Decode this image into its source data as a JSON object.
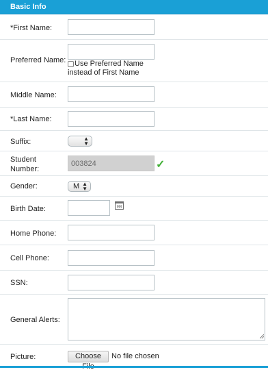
{
  "header": {
    "title": "Basic Info"
  },
  "form": {
    "first_name": {
      "label": "*First Name:",
      "value": ""
    },
    "preferred_name": {
      "label": "Preferred Name:",
      "value": "",
      "checkbox_label_line1": "Use Preferred Name",
      "checkbox_label_line2": "instead of First Name",
      "checked": false
    },
    "middle_name": {
      "label": "Middle Name:",
      "value": ""
    },
    "last_name": {
      "label": "*Last Name:",
      "value": ""
    },
    "suffix": {
      "label": "Suffix:",
      "value": ""
    },
    "student_number": {
      "label_line1": "Student",
      "label_line2": "Number:",
      "value": "003824",
      "status_icon": "check-icon"
    },
    "gender": {
      "label": "Gender:",
      "value": "M"
    },
    "birth_date": {
      "label": "Birth Date:",
      "value": "",
      "icon": "calendar-icon"
    },
    "home_phone": {
      "label": "Home Phone:",
      "value": ""
    },
    "cell_phone": {
      "label": "Cell Phone:",
      "value": ""
    },
    "ssn": {
      "label": "SSN:",
      "value": ""
    },
    "general_alerts": {
      "label": "General Alerts:",
      "value": ""
    },
    "picture": {
      "label": "Picture:",
      "button_label": "Choose File",
      "status": "No file chosen"
    }
  },
  "colors": {
    "accent": "#1aa0d6",
    "check": "#44b039",
    "disabled_bg": "#d1d1d1"
  }
}
